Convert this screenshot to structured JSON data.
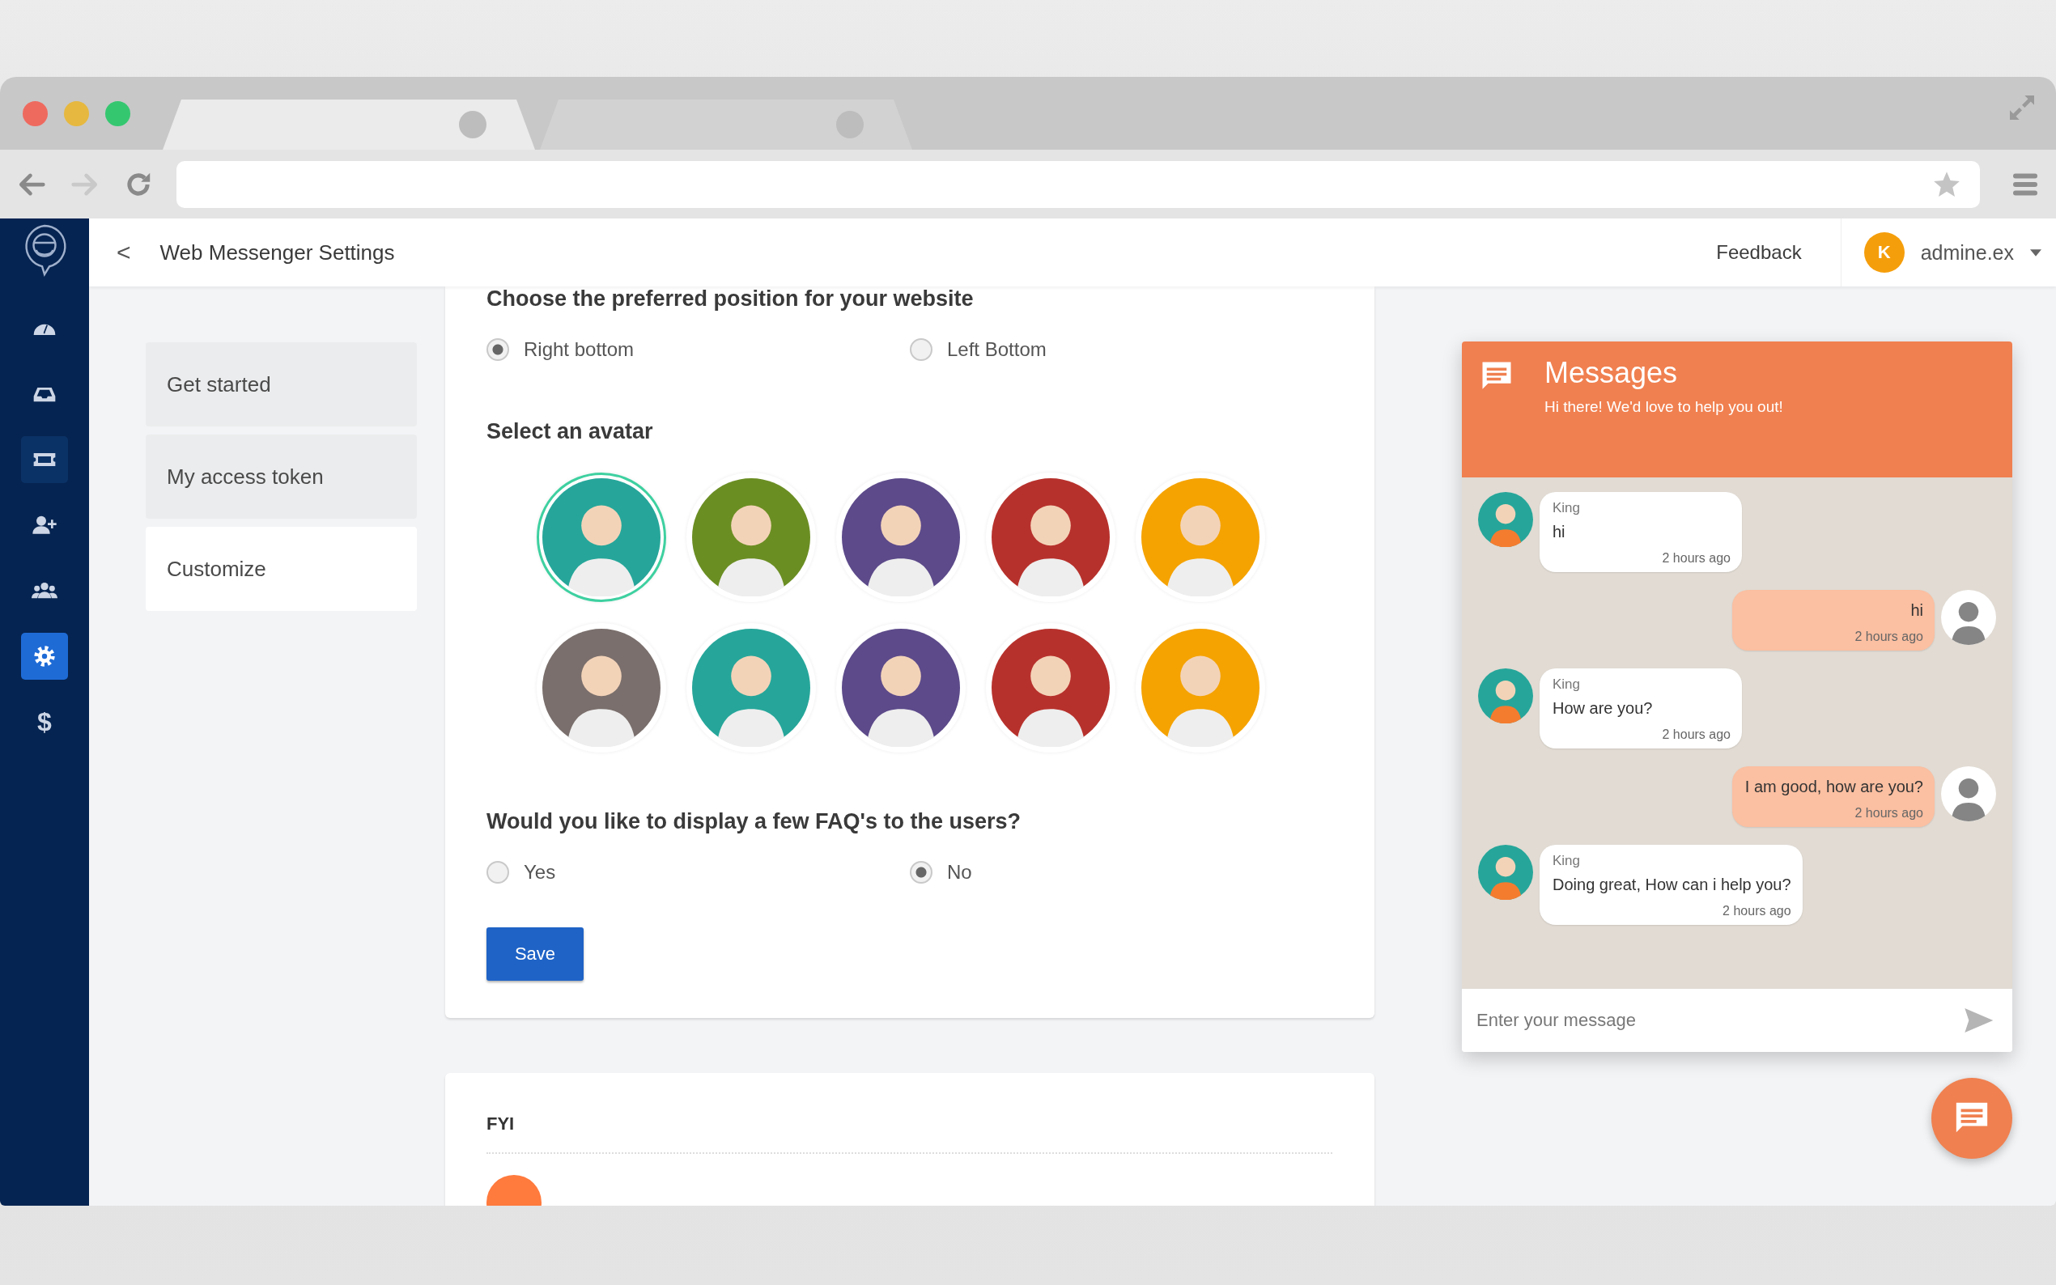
{
  "browser": {
    "window_controls": [
      {
        "color": "#ee6a5f"
      },
      {
        "color": "#e6b83f"
      },
      {
        "color": "#35c770"
      }
    ],
    "tabs": [
      {
        "selected": true
      },
      {
        "selected": false
      }
    ],
    "nav_buttons": [
      {
        "kind": "back",
        "disabled": false
      },
      {
        "kind": "forward",
        "disabled": true
      },
      {
        "kind": "reload",
        "disabled": false
      }
    ]
  },
  "sidebar": {
    "items": [
      {
        "kind": "dashboard",
        "selected": false,
        "hovered": false
      },
      {
        "kind": "inbox",
        "selected": false,
        "hovered": false
      },
      {
        "kind": "tickets",
        "selected": false,
        "hovered": true
      },
      {
        "kind": "add-user",
        "selected": false,
        "hovered": false
      },
      {
        "kind": "team",
        "selected": false,
        "hovered": false
      },
      {
        "kind": "settings",
        "selected": true,
        "hovered": false
      },
      {
        "kind": "billing",
        "glyph": "$",
        "selected": false,
        "hovered": false
      }
    ]
  },
  "header": {
    "back": "<",
    "title": "Web Messenger Settings",
    "feedback": "Feedback",
    "user": {
      "initial": "K",
      "name": "admine.ex"
    }
  },
  "settings_nav": {
    "items": [
      {
        "label": "Get started",
        "selected": false
      },
      {
        "label": "My access token",
        "selected": false
      },
      {
        "label": "Customize",
        "selected": true
      }
    ]
  },
  "form": {
    "position": {
      "question": "Choose the preferred position for your website",
      "options": [
        {
          "label": "Right bottom",
          "selected": true
        },
        {
          "label": "Left Bottom",
          "selected": false
        }
      ]
    },
    "avatar": {
      "heading": "Select an avatar",
      "avatars": [
        {
          "color": "#26a69a",
          "selected": true
        },
        {
          "color": "#6b8e23",
          "selected": false
        },
        {
          "color": "#5c4a8a",
          "selected": false
        },
        {
          "color": "#b7312c",
          "selected": false
        },
        {
          "color": "#f5a300",
          "selected": false
        },
        {
          "color": "#7a6f6c",
          "selected": false
        },
        {
          "color": "#26a69a",
          "selected": false
        },
        {
          "color": "#5c4a8a",
          "selected": false
        },
        {
          "color": "#b7312c",
          "selected": false
        },
        {
          "color": "#f5a300",
          "selected": false
        }
      ]
    },
    "faq": {
      "question": "Would you like to display a few FAQ's to the users?",
      "options": [
        {
          "label": "Yes",
          "selected": false
        },
        {
          "label": "No",
          "selected": true
        }
      ]
    },
    "save": "Save"
  },
  "fyi": {
    "heading": "FYI"
  },
  "chat": {
    "title": "Messages",
    "subtitle": "Hi there! We'd love to help you out!",
    "messages": [
      {
        "kind": "agent",
        "sender": "King",
        "text": "hi",
        "time": "2 hours ago"
      },
      {
        "kind": "user",
        "text": "hi",
        "time": "2 hours ago"
      },
      {
        "kind": "agent",
        "sender": "King",
        "text": "How are you?",
        "time": "2 hours ago"
      },
      {
        "kind": "user",
        "text": "I am good, how are you?",
        "time": "2 hours ago"
      },
      {
        "kind": "agent",
        "sender": "King",
        "text": "Doing great, How can i help you?",
        "time": "2 hours ago"
      }
    ],
    "input": {
      "placeholder": "Enter your message"
    }
  }
}
